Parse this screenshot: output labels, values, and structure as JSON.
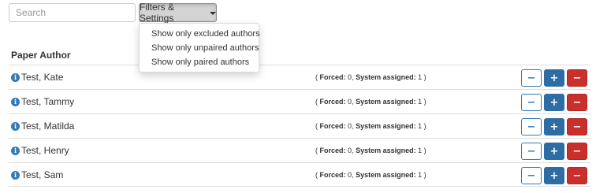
{
  "search": {
    "placeholder": "Search",
    "value": ""
  },
  "filters": {
    "label": "Filters & Settings",
    "menu": [
      "Show only excluded authors",
      "Show only unpaired authors",
      "Show only paired authors"
    ]
  },
  "table": {
    "header": "Paper Author",
    "rows": [
      {
        "name": "Test, Kate",
        "forced_label": "Forced:",
        "forced": "0",
        "system_label": "System assigned:",
        "system": "1"
      },
      {
        "name": "Test, Tammy",
        "forced_label": "Forced:",
        "forced": "0",
        "system_label": "System assigned:",
        "system": "1"
      },
      {
        "name": "Test, Matilda",
        "forced_label": "Forced:",
        "forced": "0",
        "system_label": "System assigned:",
        "system": "1"
      },
      {
        "name": "Test, Henry",
        "forced_label": "Forced:",
        "forced": "0",
        "system_label": "System assigned:",
        "system": "1"
      },
      {
        "name": "Test, Sam",
        "forced_label": "Forced:",
        "forced": "0",
        "system_label": "System assigned:",
        "system": "1"
      }
    ]
  },
  "buttons": {
    "exclude": "−",
    "add": "+",
    "remove": "−"
  },
  "icons": {
    "info": "i"
  },
  "colors": {
    "primary": "#337ab7",
    "primary_dark": "#2e6da4",
    "danger": "#c9302c"
  }
}
